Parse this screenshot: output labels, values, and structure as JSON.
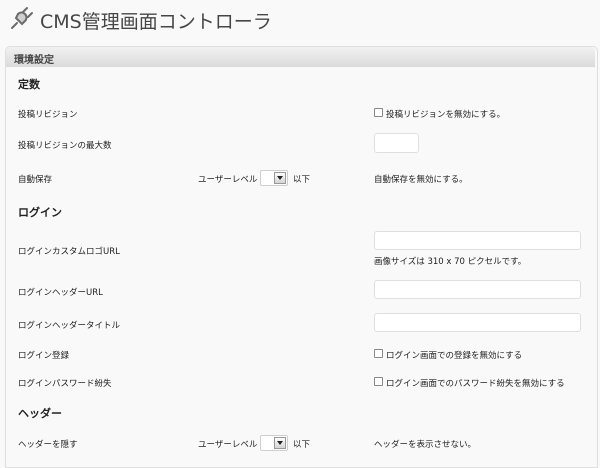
{
  "header": {
    "title": "CMS管理画面コントローラ",
    "icon": "plug-icon"
  },
  "panel": {
    "title": "環境設定"
  },
  "sections": {
    "constants": "定数",
    "login": "ログイン",
    "header": "ヘッダー"
  },
  "constants": {
    "revision_label": "投稿リビジョン",
    "revision_disable": "投稿リビジョンを無効にする。",
    "revision_max_label": "投稿リビジョンの最大数",
    "revision_max_value": "",
    "autosave_label": "自動保存",
    "autosave_level_label": "ユーザーレベル",
    "autosave_level_value": "",
    "autosave_level_suffix": "以下",
    "autosave_disable": "自動保存を無効にする。"
  },
  "login": {
    "logo_url_label": "ログインカスタムロゴURL",
    "logo_url_value": "",
    "logo_url_note": "画像サイズは 310 x 70 ピクセルです。",
    "header_url_label": "ログインヘッダーURL",
    "header_url_value": "",
    "header_title_label": "ログインヘッダータイトル",
    "header_title_value": "",
    "register_label": "ログイン登録",
    "register_disable": "ログイン画面での登録を無効にする",
    "lost_password_label": "ログインパスワード紛失",
    "lost_password_disable": "ログイン画面でのパスワード紛失を無効にする"
  },
  "header_section": {
    "hide_label": "ヘッダーを隠す",
    "level_label": "ユーザーレベル",
    "level_value": "",
    "level_suffix": "以下",
    "hide_note": "ヘッダーを表示させない。"
  }
}
